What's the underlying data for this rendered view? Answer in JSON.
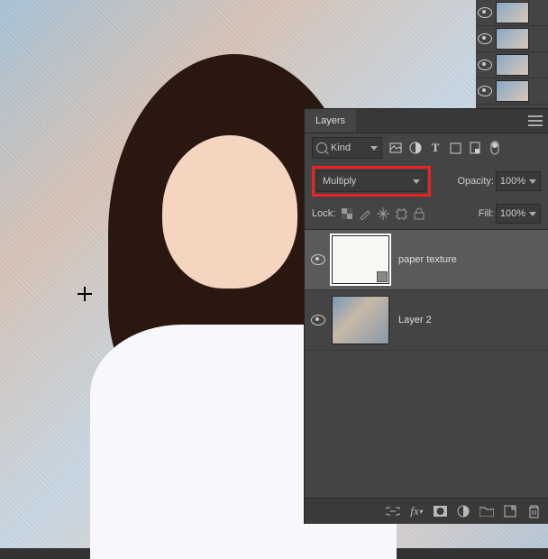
{
  "panel": {
    "title": "Layers",
    "filter": {
      "kind_label": "Kind"
    },
    "blend_mode": "Multiply",
    "opacity": {
      "label": "Opacity:",
      "value": "100%"
    },
    "fill": {
      "label": "Fill:",
      "value": "100%"
    },
    "lock_label": "Lock:",
    "layers": [
      {
        "name": "paper texture",
        "visible": true,
        "selected": true
      },
      {
        "name": "Layer 2",
        "visible": true,
        "selected": false
      }
    ]
  }
}
